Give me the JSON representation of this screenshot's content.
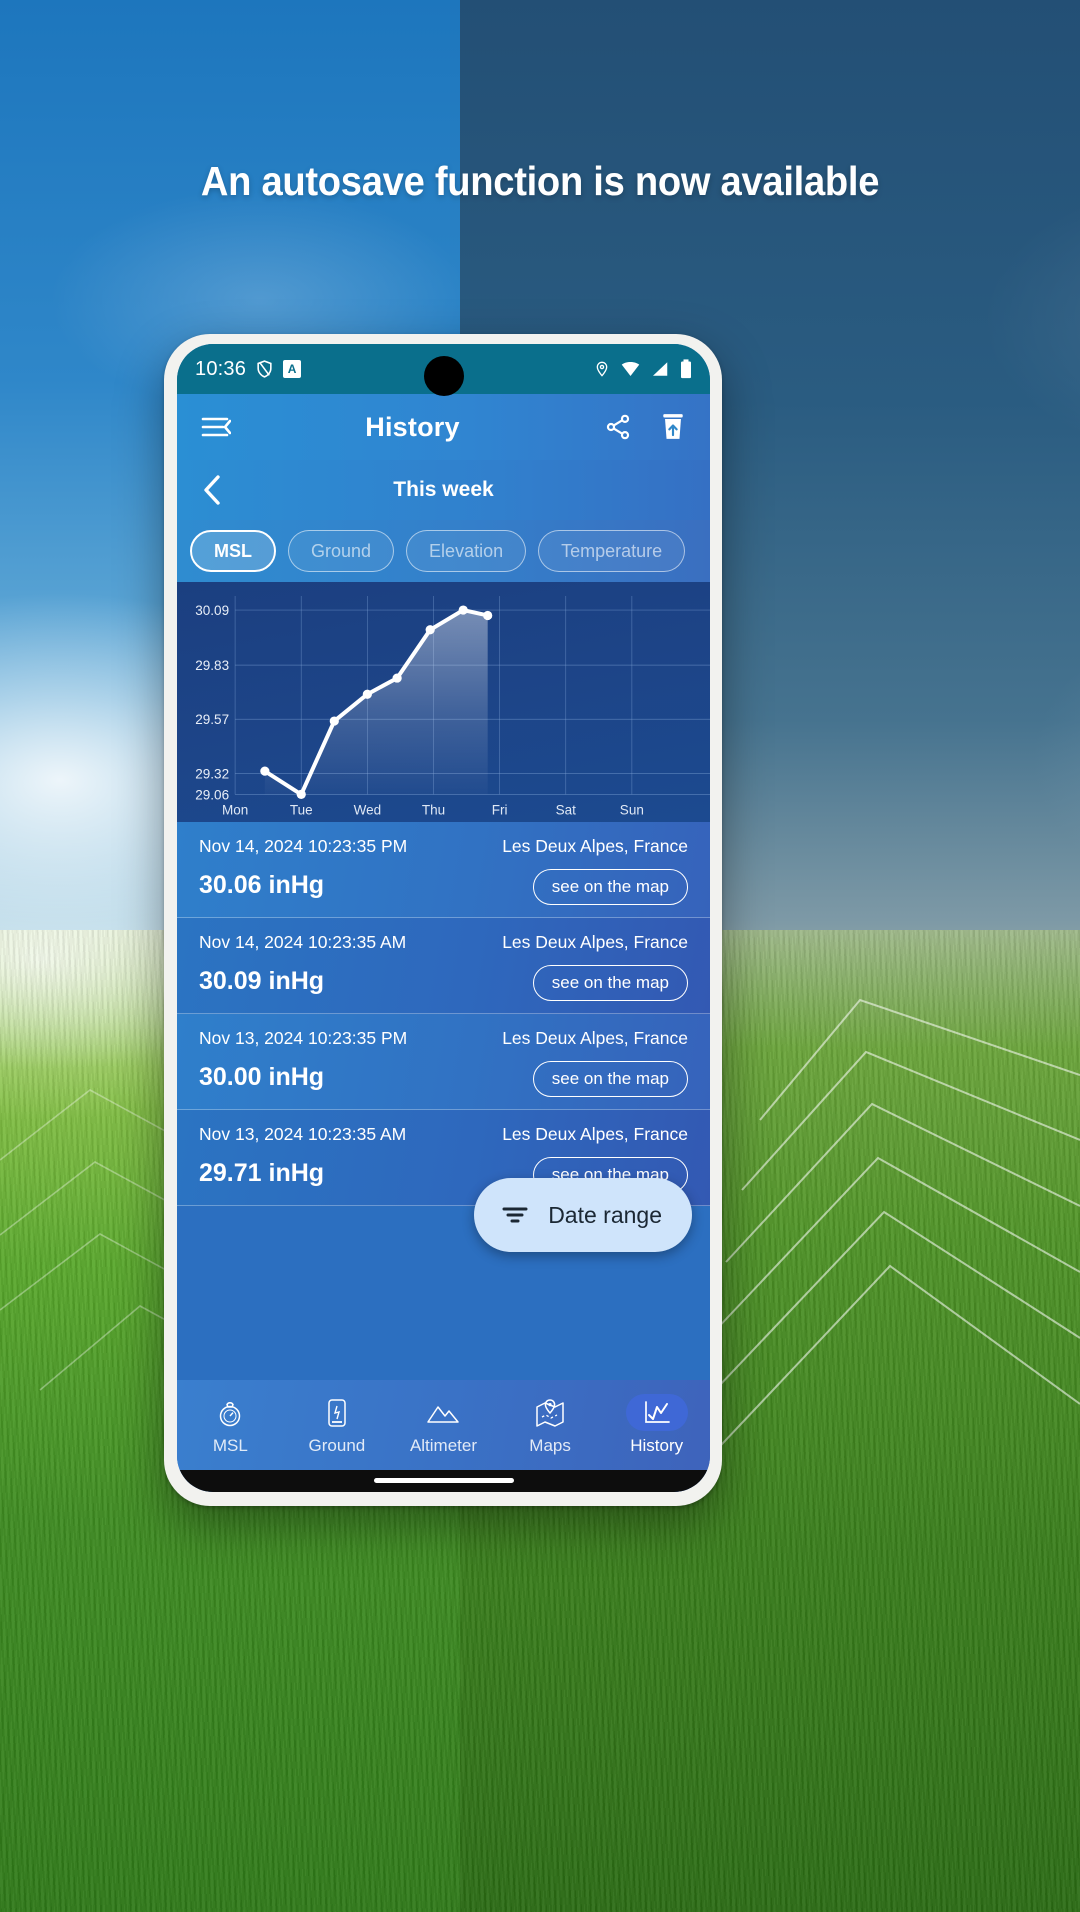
{
  "promo": {
    "headline": "An autosave function is now available"
  },
  "statusbar": {
    "time": "10:36",
    "icons": [
      "shield-icon",
      "assistant-badge-icon",
      "location-pin-icon",
      "wifi-icon",
      "cellular-signal-icon",
      "battery-icon"
    ],
    "assistant_badge": "A"
  },
  "appbar": {
    "title": "History",
    "menu_icon": "menu-back-icon",
    "share_icon": "share-icon",
    "delete_icon": "delete-archive-icon"
  },
  "week_selector": {
    "back_icon": "chevron-left-icon",
    "label": "This week"
  },
  "chips": [
    {
      "label": "MSL",
      "active": true
    },
    {
      "label": "Ground",
      "active": false
    },
    {
      "label": "Elevation",
      "active": false
    },
    {
      "label": "Temperature",
      "active": false
    }
  ],
  "chart_data": {
    "type": "line",
    "title": "",
    "xlabel": "",
    "ylabel": "",
    "unit": "inHg",
    "categories": [
      "Mon",
      "Tue",
      "Wed",
      "Thu",
      "Fri",
      "Sat",
      "Sun"
    ],
    "ytick_labels": [
      "30.09",
      "29.83",
      "29.57",
      "29.32",
      "29.06"
    ],
    "ylim": [
      29.06,
      30.09
    ],
    "grid": true,
    "legend": "none",
    "area_fill": true,
    "series": [
      {
        "name": "MSL",
        "points": [
          {
            "x": 0.45,
            "y": 29.19
          },
          {
            "x": 1.0,
            "y": 29.06
          },
          {
            "x": 1.5,
            "y": 29.47
          },
          {
            "x": 2.0,
            "y": 29.62
          },
          {
            "x": 2.45,
            "y": 29.71
          },
          {
            "x": 2.95,
            "y": 29.98
          },
          {
            "x": 3.45,
            "y": 30.09
          },
          {
            "x": 3.82,
            "y": 30.06
          }
        ]
      }
    ]
  },
  "history_rows": [
    {
      "date": "Nov 14, 2024 10:23:35 PM",
      "value": "30.06 inHg",
      "place": "Les Deux Alpes, France",
      "map_label": "see on the map"
    },
    {
      "date": "Nov 14, 2024 10:23:35 AM",
      "value": "30.09 inHg",
      "place": "Les Deux Alpes, France",
      "map_label": "see on the map"
    },
    {
      "date": "Nov 13, 2024 10:23:35 PM",
      "value": "30.00 inHg",
      "place": "Les Deux Alpes, France",
      "map_label": "see on the map"
    },
    {
      "date": "Nov 13, 2024 10:23:35 AM",
      "value": "29.71 inHg",
      "place": "Les Deux Alpes, France",
      "map_label": "see on the map"
    }
  ],
  "fab": {
    "label": "Date range",
    "icon": "filter-icon"
  },
  "bottom_nav": [
    {
      "label": "MSL",
      "icon": "gauge-icon",
      "active": false
    },
    {
      "label": "Ground",
      "icon": "phone-pressure-icon",
      "active": false
    },
    {
      "label": "Altimeter",
      "icon": "mountain-icon",
      "active": false
    },
    {
      "label": "Maps",
      "icon": "map-pin-icon",
      "active": false
    },
    {
      "label": "History",
      "icon": "chart-line-icon",
      "active": true
    }
  ],
  "colors": {
    "accent": "#2f87c9",
    "chart_bg": "#1d4487",
    "chart_line": "#ffffff",
    "fab_bg": "#cfe4fb",
    "nav_active_pill": "#3f68d6"
  }
}
